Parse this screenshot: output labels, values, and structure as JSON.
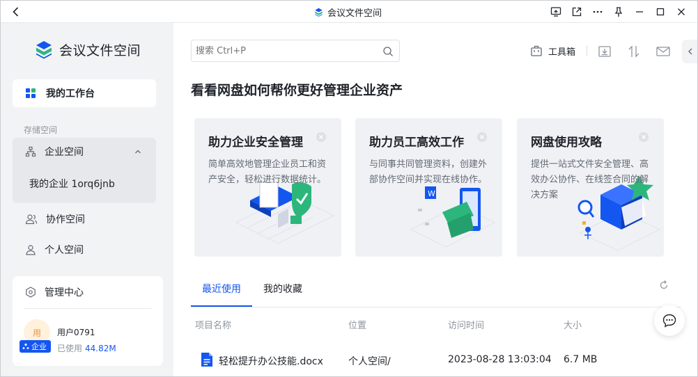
{
  "titlebar": {
    "title": "会议文件空间"
  },
  "sidebar": {
    "brand": "会议文件空间",
    "workbench": "我的工作台",
    "storage_label": "存储空间",
    "enterprise_space": "企业空间",
    "enterprise_name": "我的企业 1orq6jnb",
    "collab_space": "协作空间",
    "personal_space": "个人空间",
    "admin_center": "管理中心",
    "user": {
      "avatar_text": "用",
      "badge": "企业",
      "name": "用户0791",
      "usage_label": "已使用",
      "usage_value": "44.82M"
    }
  },
  "main": {
    "search_placeholder": "搜索 Ctrl+P",
    "toolbox": "工具箱",
    "headline": "看看网盘如何帮你更好管理企业资产",
    "cards": [
      {
        "title": "助力企业安全管理",
        "desc": "简单高效地管理企业员工和资产安全，轻松进行数据统计。"
      },
      {
        "title": "助力员工高效工作",
        "desc": "与同事共同管理资料，创建外部协作空间并实现在线协作。"
      },
      {
        "title": "网盘使用攻略",
        "desc": "提供一站式文件安全管理、高效办公协作、在线签合同的解决方案"
      }
    ],
    "tabs": [
      "最近使用",
      "我的收藏"
    ],
    "table": {
      "headers": [
        "项目名称",
        "位置",
        "访问时间",
        "大小"
      ],
      "rows": [
        {
          "name": "轻松提升办公技能.docx",
          "location": "个人空间/",
          "time": "2023-08-28 13:03:04",
          "size": "6.7 MB"
        }
      ]
    }
  },
  "colors": {
    "accent": "#1456f0",
    "brand_green": "#2db67c",
    "sidebar_bg": "#f2f3f5"
  }
}
